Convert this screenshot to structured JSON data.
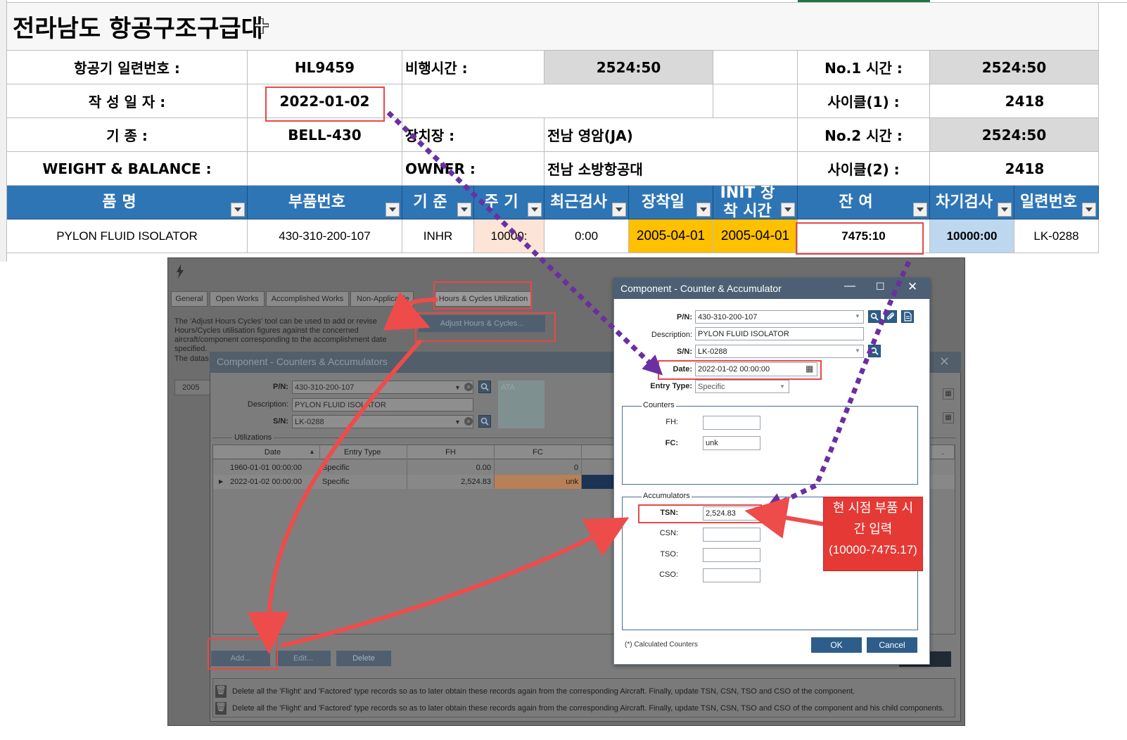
{
  "sheet": {
    "title": "전라남도 항공구조구급대",
    "rows": [
      {
        "label": "항공기  일련번호 :",
        "value": "HL9459",
        "label2": "비행시간 :",
        "value2": "2524:50",
        "label3": "No.1 시간 :",
        "value3": "2524:50"
      },
      {
        "label": "작   성   일   자 :",
        "value": "2022-01-02",
        "label3": "사이클(1) :",
        "value3": "2418"
      },
      {
        "label": "기                종 :",
        "value": "BELL-430",
        "label2": "장치장 :",
        "value2": "전남 영암(JA)",
        "label3": "No.2 시간 :",
        "value3": "2524:50"
      },
      {
        "label": "WEIGHT & BALANCE :",
        "value": "",
        "label2": "OWNER :",
        "value2": "전남 소방항공대",
        "label3": "사이클(2) :",
        "value3": "2418"
      }
    ],
    "headers": [
      "품      명",
      "부품번호",
      "기 준",
      "주 기",
      "최근검사",
      "장착일",
      "INIT 장착 시간",
      "잔 여",
      "차기검사",
      "일련번호"
    ],
    "data_row": [
      "PYLON FLUID ISOLATOR",
      "430-310-200-107",
      "INHR",
      "10000:",
      "0:00",
      "2005-04-01",
      "2005-04-01",
      "7475:10",
      "10000:00",
      "LK-0288"
    ],
    "colors": {
      "header_bg": "#2e75b6",
      "peach": "#fce4d6",
      "orange": "#ffc000",
      "lightblue": "#bdd7ee",
      "gray": "#d9d9d9",
      "red_box": "#e8474a"
    }
  },
  "app": {
    "tabs": [
      "General",
      "Open Works",
      "Accomplished  Works",
      "Non-Applicable",
      "Hours & Cycles Utilization"
    ],
    "help_text": [
      "The 'Adjust Hours  Cycles' tool can be used to add or revise",
      "Hours/Cycles utilisation figures against the concerned",
      "aircraft/component corresponding to the accomplishment date specified."
    ],
    "adjust_button": "Adjust Hours & Cycles...",
    "dataset_text": "The datas",
    "row_prefix": "2005",
    "inner_window": {
      "title": "Component - Counters & Accumulators",
      "pn_label": "P/N:",
      "pn_value": "430-310-200-107",
      "desc_label": "Description:",
      "desc_value": "PYLON FLUID ISOLATOR",
      "sn_label": "S/N:",
      "sn_value": "LK-0288",
      "ata_label": "ATA",
      "utilizations_label": "Utilizations",
      "columns": [
        "Date",
        "Entry Type",
        "FH",
        "FC"
      ],
      "rows": [
        {
          "date": "1960-01-01 00:00:00",
          "type": "Specific",
          "fh": "0.00",
          "fc": "0"
        },
        {
          "date": "2022-01-02 00:00:00",
          "type": "Specific",
          "fh": "2,524.83",
          "fc": "unk"
        }
      ],
      "buttons": {
        "add": "Add...",
        "edit": "Edit...",
        "delete": "Delete"
      },
      "footer_lines": [
        "Delete all the 'Flight' and 'Factored' type records so as to later obtain these records again from the corresponding Aircraft. Finally, update TSN, CSN, TSO and CSO of the component.",
        "Delete all the 'Flight' and 'Factored' type records so as to later obtain these records again from the corresponding Aircraft. Finally, update TSN, CSN, TSO and CSO of the component and his child components."
      ]
    }
  },
  "dialog": {
    "title": "Component - Counter & Accumulator",
    "pn_label": "P/N:",
    "pn_value": "430-310-200-107",
    "desc_label": "Description:",
    "desc_value": "PYLON FLUID ISOLATOR",
    "sn_label": "S/N:",
    "sn_value": "LK-0288",
    "date_label": "Date:",
    "date_value": "2022-01-02 00:00:00",
    "entry_label": "Entry Type:",
    "entry_value": "Specific",
    "counters_label": "Counters",
    "fh_label": "FH:",
    "fh_value": "",
    "fc_label": "FC:",
    "fc_value": "unk",
    "accumulators_label": "Accumulators",
    "tsn_label": "TSN:",
    "tsn_value": "2,524.83",
    "csn_label": "CSN:",
    "csn_value": "",
    "tso_label": "TSO:",
    "tso_value": "",
    "cso_label": "CSO:",
    "cso_value": "",
    "calc_note": "(*) Calculated Counters",
    "ok": "OK",
    "cancel": "Cancel"
  },
  "callout": {
    "lines": [
      "현 시점 부품 시",
      "간 입력",
      "(10000-7475.17)"
    ]
  }
}
